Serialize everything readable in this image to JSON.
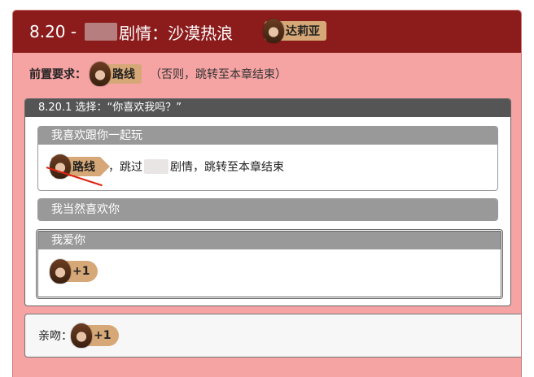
{
  "header": {
    "title_prefix": "8.20 - ",
    "title_suffix": "剧情：沙漠热浪",
    "character": "达莉亚"
  },
  "requirement": {
    "label": "前置要求：",
    "route_label": "路线",
    "note": "（否则，跳转至本章结束）"
  },
  "choice_section": {
    "title": "8.20.1 选择：“你喜欢我吗？”",
    "options": [
      {
        "label": "我喜欢跟你一起玩",
        "route_label": "路线",
        "text_prefix": "，跳过",
        "text_suffix": "剧情，跳转至本章结束"
      },
      {
        "label": "我当然喜欢你"
      },
      {
        "label": "我爱你",
        "reward": "+1"
      }
    ]
  },
  "kiss": {
    "label": "亲吻：",
    "reward": "+1"
  },
  "colors": {
    "header_bg": "#8c1c1c",
    "card_bg": "#f5a3a3",
    "badge_bg": "#d7a877",
    "section_head": "#555555",
    "option_head": "#999999"
  }
}
